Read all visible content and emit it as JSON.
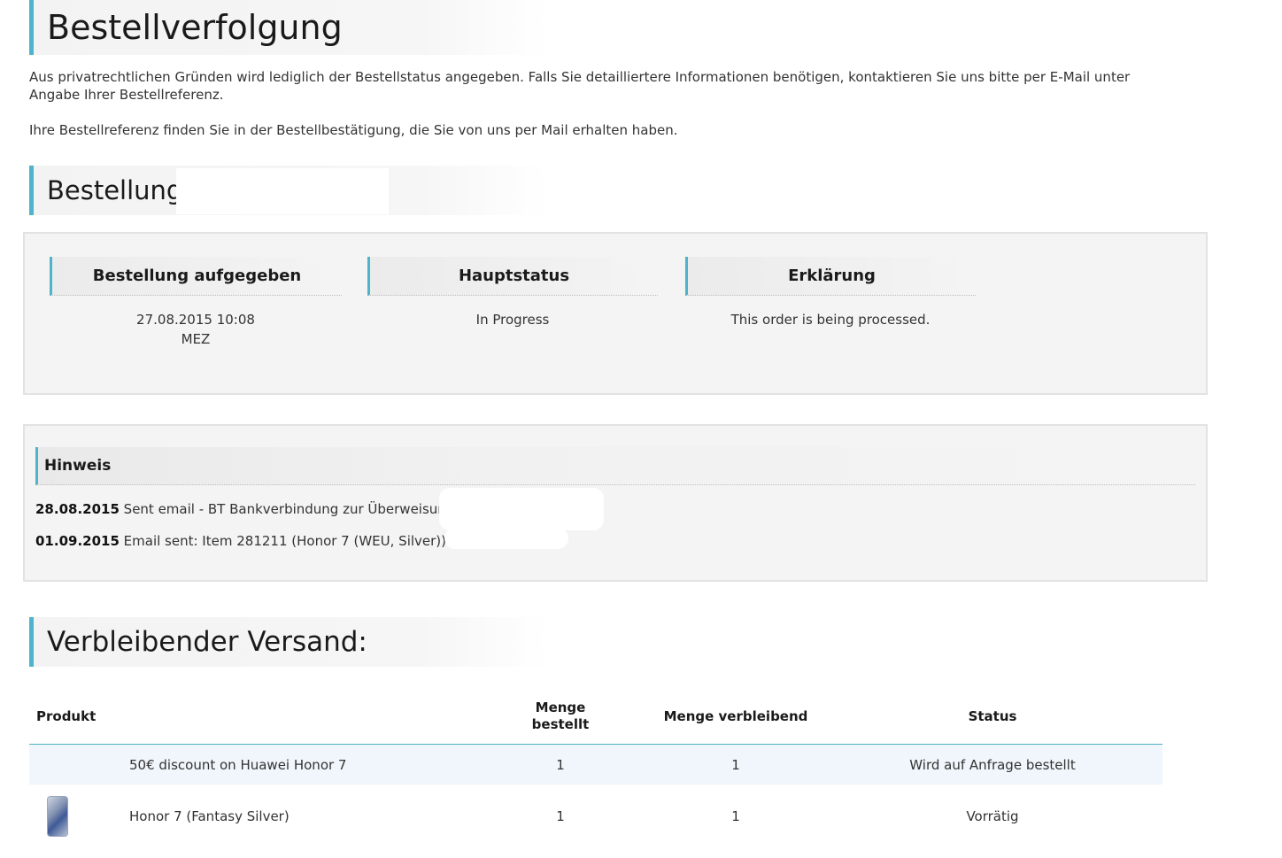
{
  "page_title": "Bestellverfolgung",
  "intro": {
    "paragraph1": "Aus privatrechtlichen Gründen wird lediglich der Bestellstatus angegeben. Falls Sie detailliertere Informationen benötigen, kontaktieren Sie uns bitte per E-Mail unter Angabe Ihrer Bestellreferenz.",
    "paragraph2": "Ihre Bestellreferenz finden Sie in der Bestellbestätigung, die Sie von uns per Mail erhalten haben."
  },
  "order": {
    "title": "Bestellung:",
    "columns": [
      {
        "header": "Bestellung aufgegeben",
        "value": "27.08.2015 10:08",
        "value2": "MEZ"
      },
      {
        "header": "Hauptstatus",
        "value": "In Progress",
        "value2": ""
      },
      {
        "header": "Erklärung",
        "value": "This order is being processed.",
        "value2": ""
      }
    ]
  },
  "notes": {
    "title": "Hinweis",
    "items": [
      {
        "date": "28.08.2015",
        "text": " Sent email - BT Bankverbindung zur Überweisung"
      },
      {
        "date": "01.09.2015",
        "text": " Email sent: Item 281211 (Honor 7 (WEU, Silver))"
      }
    ]
  },
  "shipping": {
    "title": "Verbleibender Versand:",
    "headers": {
      "product": "Produkt",
      "qty_ordered": "Menge\nbestellt",
      "qty_remaining": "Menge verbleibend",
      "status": "Status"
    },
    "rows": [
      {
        "has_image": false,
        "name": "50€ discount on Huawei Honor 7",
        "qty_ordered": "1",
        "qty_remaining": "1",
        "status": "Wird auf Anfrage bestellt"
      },
      {
        "has_image": true,
        "image_icon": "phone-image",
        "name": "Honor 7 (Fantasy Silver)",
        "qty_ordered": "1",
        "qty_remaining": "1",
        "status": "Vorrätig"
      }
    ]
  },
  "colors": {
    "accent": "#4fb3c9",
    "panel_bg": "#f4f4f4",
    "row_highlight": "#f0f6fb"
  }
}
